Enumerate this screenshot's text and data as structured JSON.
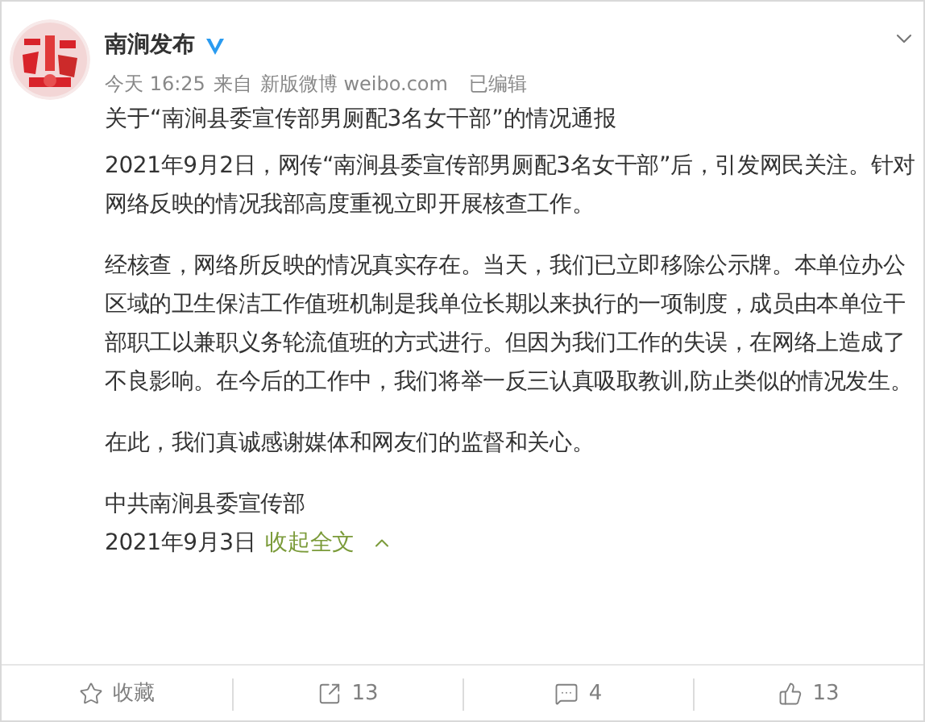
{
  "account": {
    "name": "南涧发布",
    "verified": true,
    "time": "今天 16:25",
    "source_prefix": "来自",
    "source": "新版微博 weibo.com",
    "edited": "已编辑"
  },
  "post": {
    "title": "关于“南涧县委宣传部男厕配3名女干部”的情况通报",
    "paragraphs": [
      "2021年9月2日，网传“南涧县委宣传部男厕配3名女干部”后，引发网民关注。针对网络反映的情况我部高度重视立即开展核查工作。",
      "经核查，网络所反映的情况真实存在。当天，我们已立即移除公示牌。本单位办公区域的卫生保洁工作值班机制是我单位长期以来执行的一项制度，成员由本单位干部职工以兼职义务轮流值班的方式进行。但因为我们工作的失误，在网络上造成了不良影响。在今后的工作中，我们将举一反三认真吸取教训,防止类似的情况发生。",
      "在此，我们真诚感谢媒体和网友们的监督和关心。"
    ],
    "signature": "中共南涧县委宣传部",
    "date": "2021年9月3日",
    "collapse_link": "收起全文"
  },
  "actions": [
    {
      "kind": "favorite",
      "label": "收藏"
    },
    {
      "kind": "repost",
      "label": "13"
    },
    {
      "kind": "comment",
      "label": "4"
    },
    {
      "kind": "like",
      "label": "13"
    }
  ]
}
